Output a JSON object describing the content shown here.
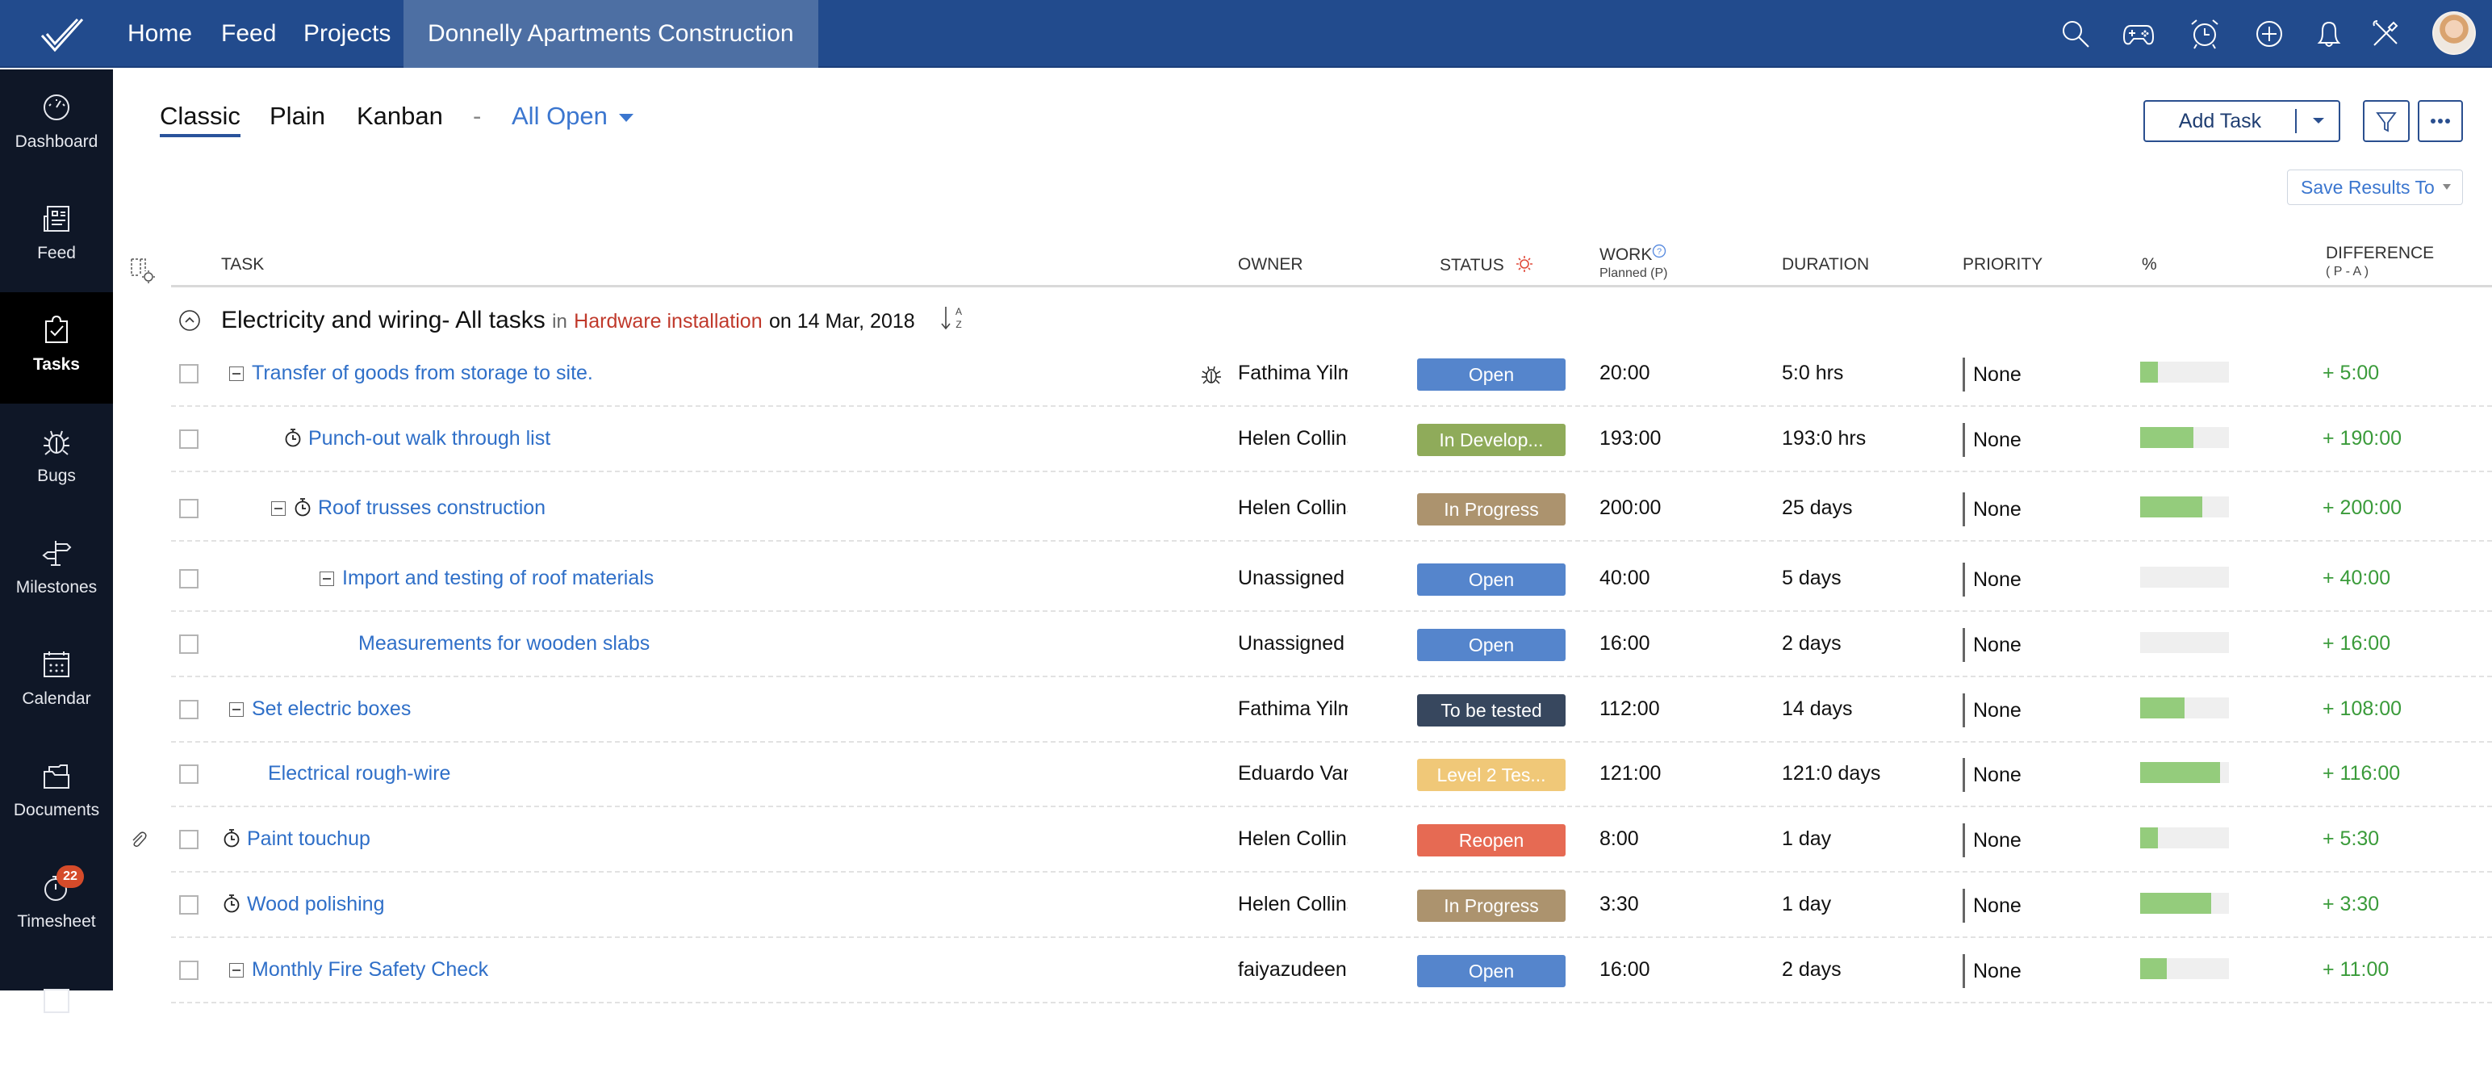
{
  "topbar": {
    "nav": [
      "Home",
      "Feed",
      "Projects"
    ],
    "active_project": "Donnelly Apartments Construction",
    "icons": [
      "search-icon",
      "gamepad-icon",
      "alarm-clock-icon",
      "add-circle-icon",
      "bell-icon",
      "tools-icon"
    ]
  },
  "sidebar": {
    "items": [
      {
        "label": "Dashboard",
        "icon": "dashboard-icon"
      },
      {
        "label": "Feed",
        "icon": "feed-icon"
      },
      {
        "label": "Tasks",
        "icon": "tasks-icon",
        "active": true
      },
      {
        "label": "Bugs",
        "icon": "bug-icon"
      },
      {
        "label": "Milestones",
        "icon": "signpost-icon"
      },
      {
        "label": "Calendar",
        "icon": "calendar-icon"
      },
      {
        "label": "Documents",
        "icon": "folder-icon"
      },
      {
        "label": "Timesheet",
        "icon": "timer-icon",
        "badge": "22"
      }
    ]
  },
  "views": {
    "tabs": [
      "Classic",
      "Plain",
      "Kanban"
    ],
    "active": "Classic",
    "separator": "-",
    "filter": "All Open"
  },
  "toolbar": {
    "add_task": "Add Task",
    "save_results": "Save Results To"
  },
  "columns": {
    "task": "TASK",
    "owner": "OWNER",
    "status": "STATUS",
    "work": "WORK",
    "work_sub": "Planned (P)",
    "duration": "DURATION",
    "priority": "PRIORITY",
    "percent": "%",
    "difference": "DIFFERENCE",
    "difference_sub": "( P - A )"
  },
  "group": {
    "title": "Electricity and wiring- All tasks",
    "in": "in",
    "project": "Hardware installation",
    "on": "on 14 Mar, 2018"
  },
  "tasks": [
    {
      "name": "Transfer of goods from storage to site.",
      "owner": "Fathima Yilmaz",
      "status": "Open",
      "status_color": "#5585cc",
      "work": "20:00",
      "duration": "5:0 hrs",
      "priority": "None",
      "percent": 20,
      "difference": "+ 5:00"
    },
    {
      "name": "Punch-out walk through list",
      "owner": "Helen Collins",
      "status": "In Develop...",
      "status_color": "#8fab5a",
      "work": "193:00",
      "duration": "193:0 hrs",
      "priority": "None",
      "percent": 60,
      "difference": "+ 190:00"
    },
    {
      "name": "Roof trusses construction",
      "owner": "Helen Collins",
      "status": "In Progress",
      "status_color": "#ac936e",
      "work": "200:00",
      "duration": "25 days",
      "priority": "None",
      "percent": 70,
      "difference": "+ 200:00"
    },
    {
      "name": "Import and testing of roof materials",
      "owner": "Unassigned",
      "status": "Open",
      "status_color": "#5585cc",
      "work": "40:00",
      "duration": "5 days",
      "priority": "None",
      "percent": 0,
      "difference": "+ 40:00"
    },
    {
      "name": "Measurements for wooden slabs",
      "owner": "Unassigned",
      "status": "Open",
      "status_color": "#5585cc",
      "work": "16:00",
      "duration": "2 days",
      "priority": "None",
      "percent": 0,
      "difference": "+ 16:00"
    },
    {
      "name": "Set electric boxes",
      "owner": "Fathima Yilmaz",
      "status": "To be tested",
      "status_color": "#37475e",
      "work": "112:00",
      "duration": "14 days",
      "priority": "None",
      "percent": 50,
      "difference": "+ 108:00"
    },
    {
      "name": "Electrical rough-wire",
      "owner": "Eduardo Vargas",
      "status": "Level 2 Tes...",
      "status_color": "#f0c878",
      "work": "121:00",
      "duration": "121:0 days",
      "priority": "None",
      "percent": 90,
      "difference": "+ 116:00"
    },
    {
      "name": "Paint touchup",
      "owner": "Helen Collins",
      "status": "Reopen",
      "status_color": "#e66a53",
      "work": "8:00",
      "duration": "1 day",
      "priority": "None",
      "percent": 20,
      "difference": "+ 5:30"
    },
    {
      "name": "Wood polishing",
      "owner": "Helen Collins",
      "status": "In Progress",
      "status_color": "#ac936e",
      "work": "3:30",
      "duration": "1 day",
      "priority": "None",
      "percent": 80,
      "difference": "+ 3:30"
    },
    {
      "name": "Monthly Fire Safety Check",
      "owner": "faiyazudeen",
      "status": "Open",
      "status_color": "#5585cc",
      "work": "16:00",
      "duration": "2 days",
      "priority": "None",
      "percent": 30,
      "difference": "+ 11:00"
    }
  ]
}
